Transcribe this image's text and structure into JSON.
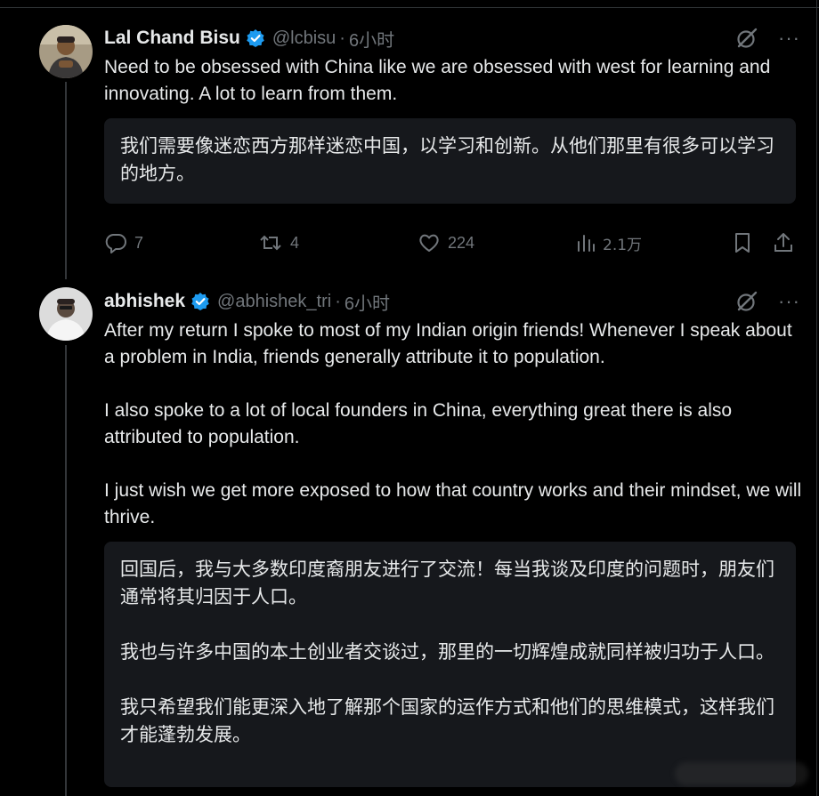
{
  "tweets": [
    {
      "name": "Lal Chand Bisu",
      "handle": "@lcbisu",
      "time": "6小时",
      "text": "Need to be obsessed with China like we are obsessed with west for learning and innovating. A lot to learn from them.",
      "translation": "我们需要像迷恋西方那样迷恋中国，以学习和创新。从他们那里有很多可以学习的地方。",
      "stats": {
        "replies": "7",
        "reposts": "4",
        "likes": "224",
        "views": "2.1万"
      }
    },
    {
      "name": "abhishek",
      "handle": "@abhishek_tri",
      "time": "6小时",
      "text": "After my return I spoke to most of my Indian origin friends! Whenever I speak about a problem in India, friends generally attribute it to population.\n\nI also spoke to a lot of local founders in China, everything great there is also attributed to population.\n\nI just wish we get more exposed to how that country works and their mindset, we will thrive.",
      "translation": "回国后，我与大多数印度裔朋友进行了交流！每当我谈及印度的问题时，朋友们通常将其归因于人口。\n\n我也与许多中国的本土创业者交谈过，那里的一切辉煌成就同样被归功于人口。\n\n我只希望我们能更深入地了解那个国家的运作方式和他们的思维模式，这样我们才能蓬勃发展。"
    }
  ],
  "separator": "·",
  "more_glyph": "···",
  "colors": {
    "background": "#000000",
    "text": "#e7e9ea",
    "secondary": "#71767b",
    "verified": "#1d9bf0",
    "translation_bg": "#16181c"
  },
  "icons": [
    "verified-badge-icon",
    "grok-icon",
    "more-icon",
    "reply-icon",
    "repost-icon",
    "like-icon",
    "views-icon",
    "bookmark-icon",
    "share-icon"
  ]
}
